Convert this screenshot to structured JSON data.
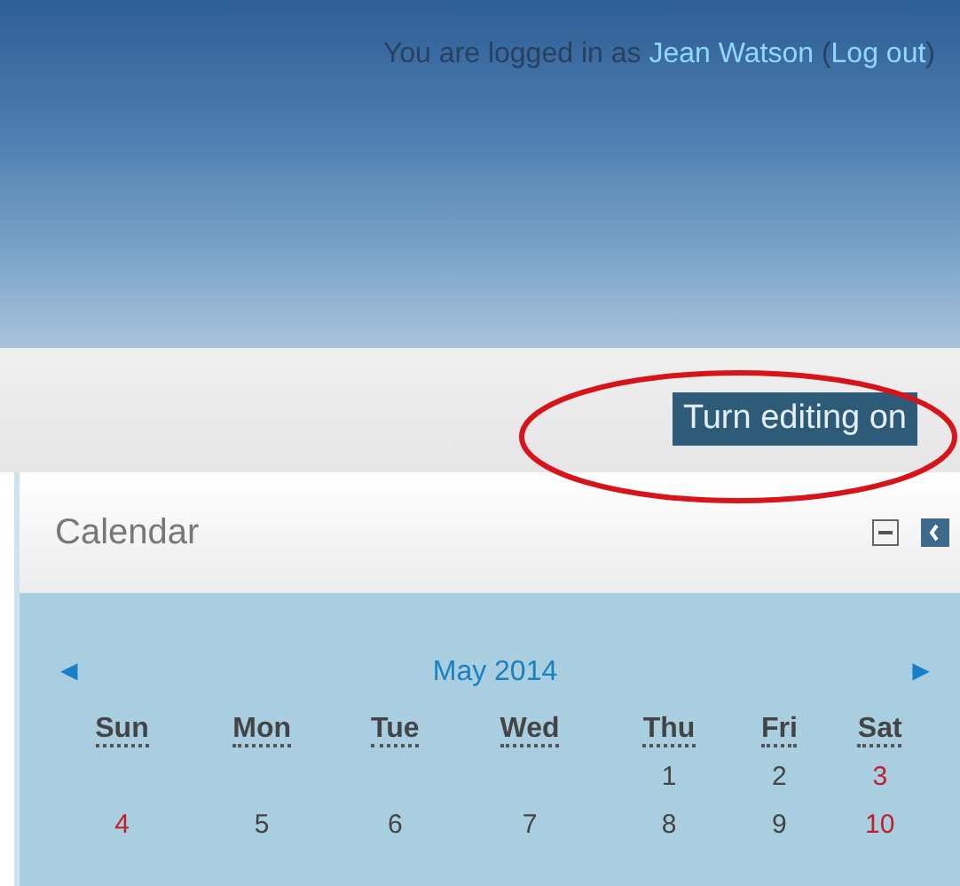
{
  "login": {
    "prefix": "You are logged in as",
    "user": "Jean Watson",
    "open": "(",
    "logout": "Log out",
    "close": ")"
  },
  "edit_button": {
    "label": "Turn editing on",
    "highlighted": true
  },
  "calendar": {
    "title": "Calendar",
    "month": "May 2014",
    "prev": "◄",
    "next": "►",
    "weekdays": [
      "Sun",
      "Mon",
      "Tue",
      "Wed",
      "Thu",
      "Fri",
      "Sat"
    ],
    "weeks": [
      [
        {
          "kind": "blank"
        },
        {
          "kind": "blank"
        },
        {
          "kind": "blank"
        },
        {
          "kind": "blank"
        },
        {
          "kind": "day",
          "day": "1",
          "weekend": false
        },
        {
          "kind": "day",
          "day": "2",
          "weekend": false
        },
        {
          "kind": "day",
          "day": "3",
          "weekend": true
        }
      ],
      [
        {
          "kind": "day",
          "day": "4",
          "weekend": true
        },
        {
          "kind": "day",
          "day": "5",
          "weekend": false
        },
        {
          "kind": "day",
          "day": "6",
          "weekend": false
        },
        {
          "kind": "day",
          "day": "7",
          "weekend": false
        },
        {
          "kind": "day",
          "day": "8",
          "weekend": false
        },
        {
          "kind": "day",
          "day": "9",
          "weekend": false
        },
        {
          "kind": "day",
          "day": "10",
          "weekend": true
        }
      ]
    ]
  }
}
